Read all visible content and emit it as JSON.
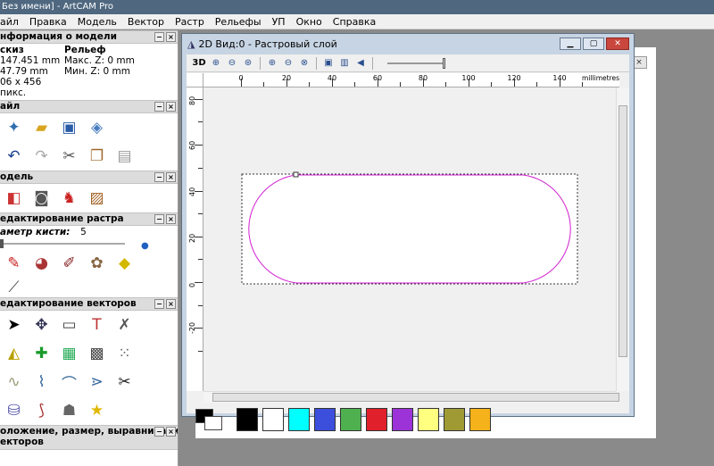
{
  "app": {
    "title": "Без имени] - ArtCAM Pro"
  },
  "menu": [
    "айл",
    "Правка",
    "Модель",
    "Вектор",
    "Растр",
    "Рельефы",
    "УП",
    "Окно",
    "Справка"
  ],
  "sections": {
    "model_info": {
      "title": "нформация о модели",
      "sketch_label": "скиз",
      "relief_label": "Рельеф",
      "w": "147.451 mm",
      "h": "47.79 mm",
      "px": "06 x 456 пикс.",
      "maxz": "Макс. Z: 0 mm",
      "minz": "Мин. Z: 0 mm"
    },
    "file": {
      "title": "айл"
    },
    "model": {
      "title": "одель"
    },
    "raster_edit": {
      "title": "едактирование растра",
      "brush_label": "аметр кисти:",
      "brush_value": "5"
    },
    "vector_edit": {
      "title": "едактирование векторов"
    },
    "position": {
      "title": "оложение, размер, выравнивание",
      "title2": "екторов"
    }
  },
  "window": {
    "title": "2D Вид:0 - Растровый слой",
    "toolbar_3d": "3D",
    "ruler_unit": "millimetres",
    "ruler_x": [
      "0",
      "20",
      "40",
      "60",
      "80",
      "100",
      "120",
      "140"
    ],
    "ruler_y": [
      "80",
      "60",
      "40",
      "20",
      "0",
      "-20"
    ]
  },
  "palette": {
    "colors": [
      "#000000",
      "#ffffff",
      "#00ffff",
      "#3b4fdc",
      "#4fb04f",
      "#e0202a",
      "#9b33d8",
      "#ffff80",
      "#a09a35",
      "#f5b21a"
    ]
  },
  "shape": {
    "stroke": "#d21fd2"
  }
}
